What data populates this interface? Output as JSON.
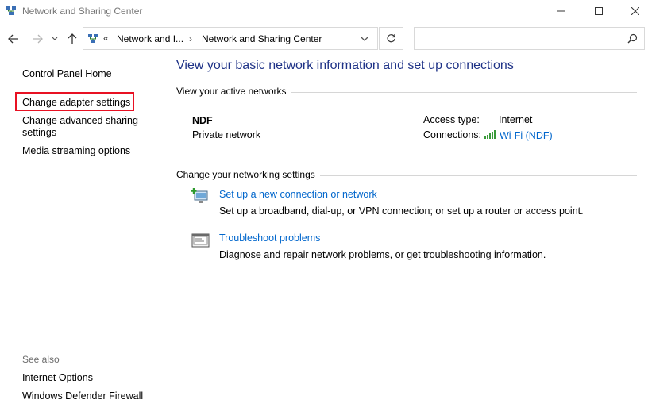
{
  "window": {
    "title": "Network and Sharing Center"
  },
  "navbar": {
    "overflow": "«",
    "breadcrumbs": [
      "Network and I...",
      "Network and Sharing Center"
    ],
    "separator": "›",
    "search_placeholder": ""
  },
  "sidebar": {
    "home": "Control Panel Home",
    "adapter": "Change adapter settings",
    "advanced": "Change advanced sharing settings",
    "media": "Media streaming options",
    "see_also_label": "See also",
    "see_also": [
      "Internet Options",
      "Windows Defender Firewall"
    ]
  },
  "main": {
    "title": "View your basic network information and set up connections",
    "active_networks_heading": "View your active networks",
    "network": {
      "name": "NDF",
      "category": "Private network",
      "access_type_label": "Access type:",
      "access_type_value": "Internet",
      "connections_label": "Connections:",
      "connections_value": "Wi-Fi (NDF)"
    },
    "settings_heading": "Change your networking settings",
    "tasks": [
      {
        "icon": "new-connection-icon",
        "link": "Set up a new connection or network",
        "description": "Set up a broadband, dial-up, or VPN connection; or set up a router or access point."
      },
      {
        "icon": "troubleshoot-icon",
        "link": "Troubleshoot problems",
        "description": "Diagnose and repair network problems, or get troubleshooting information."
      }
    ]
  },
  "colors": {
    "title_blue": "#1e3287",
    "link_blue": "#0066cc",
    "highlight_red": "#e81123"
  }
}
